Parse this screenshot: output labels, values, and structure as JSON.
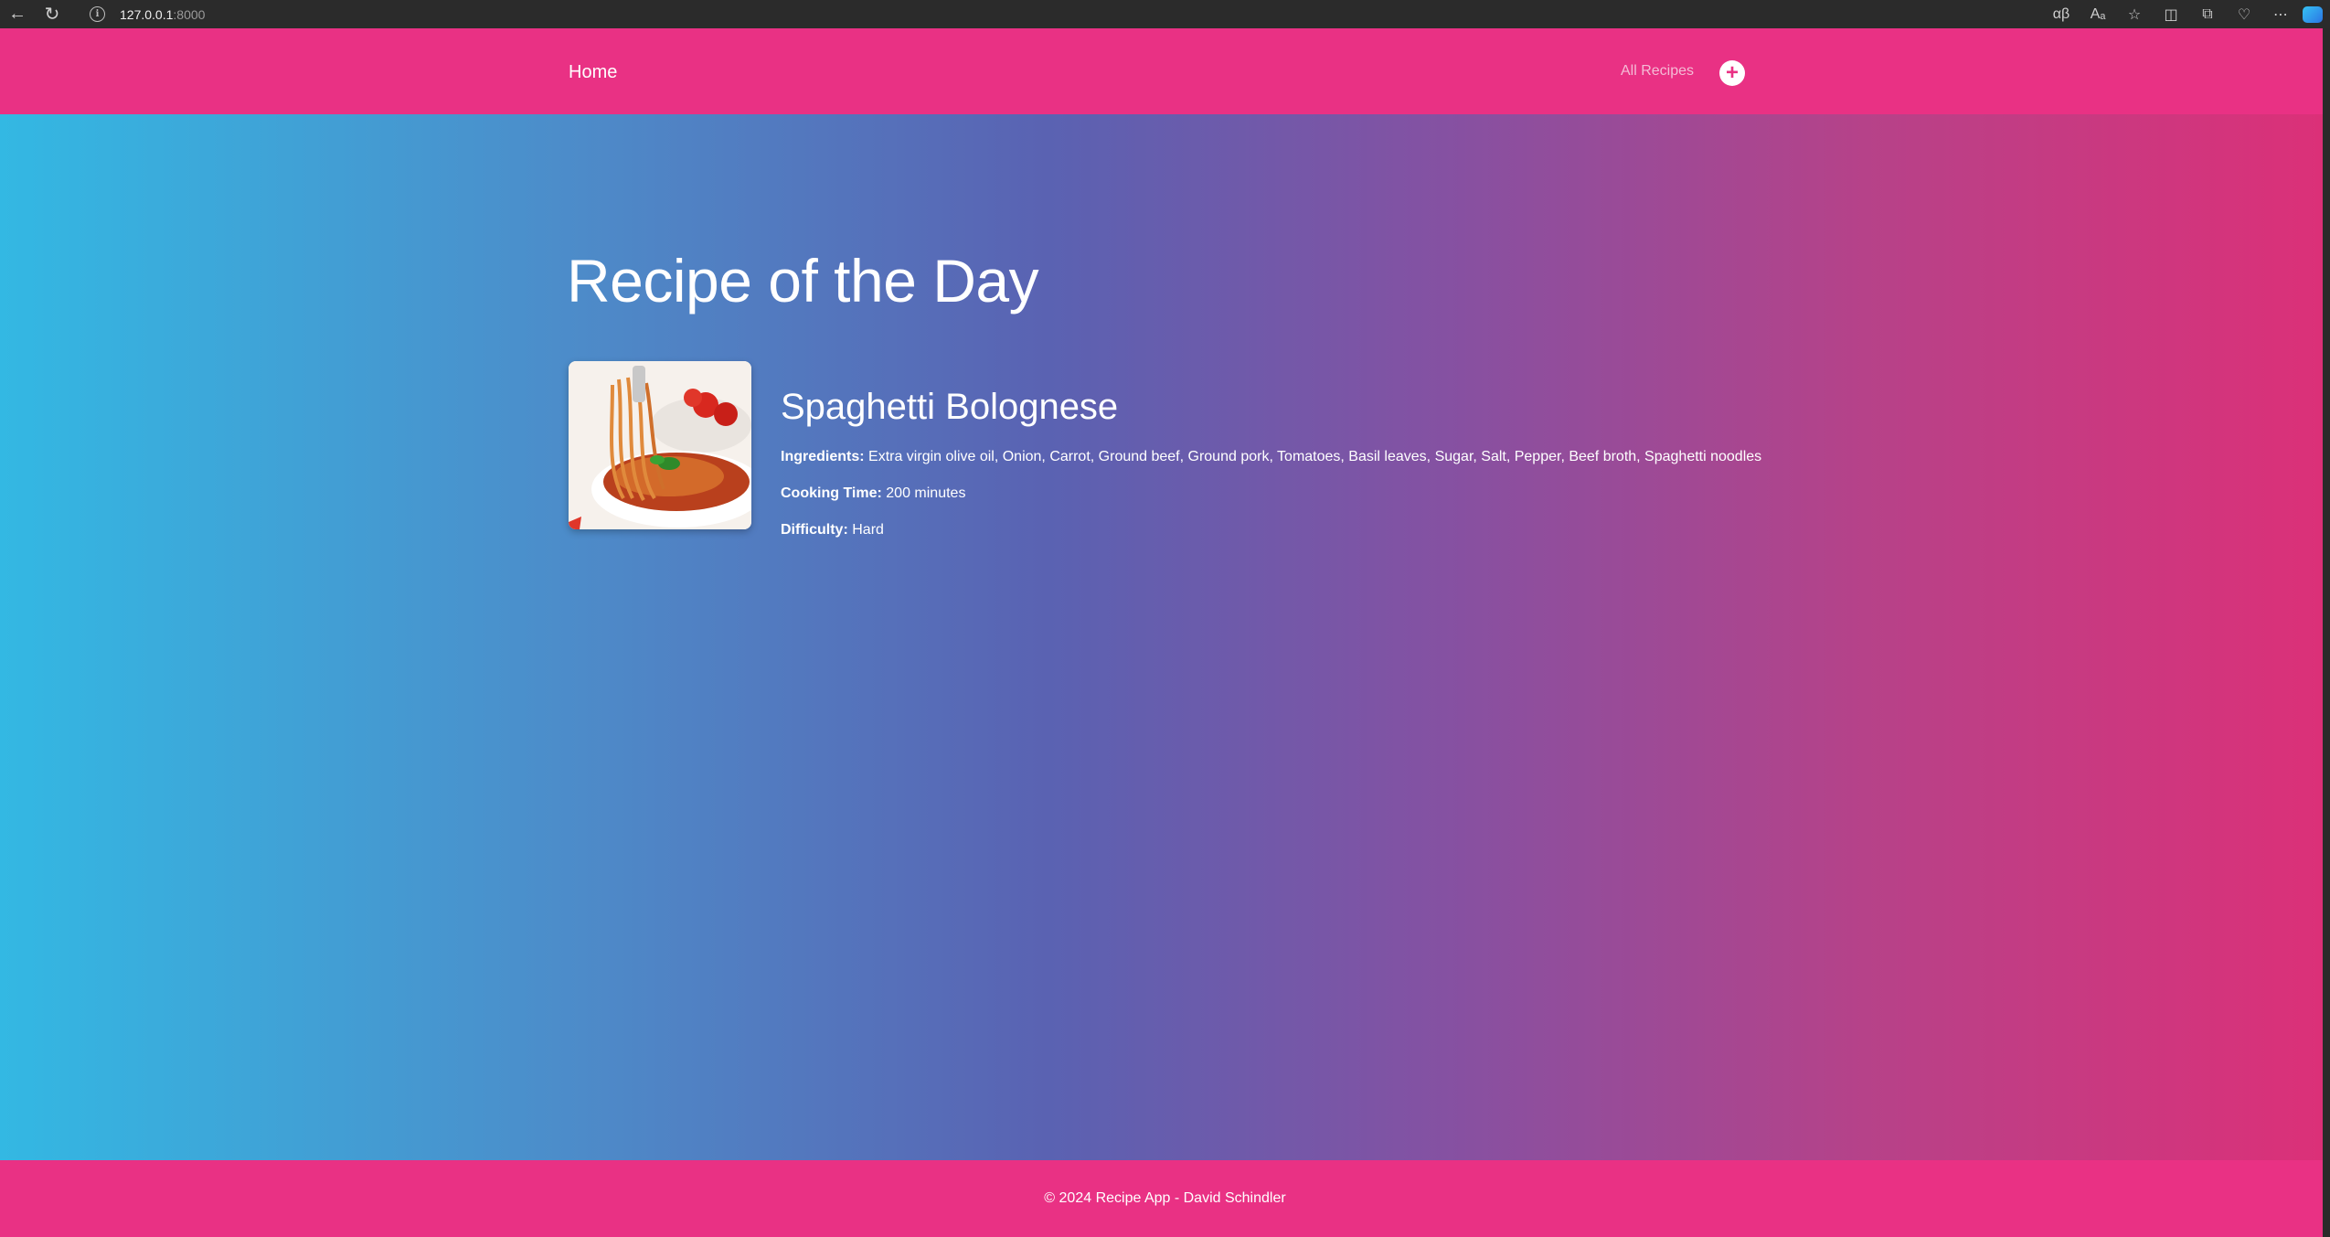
{
  "browser": {
    "url_host": "127.0.0.1",
    "url_port": ":8000"
  },
  "nav": {
    "brand": "Home",
    "all_recipes": "All Recipes",
    "add_symbol": "+"
  },
  "hero": {
    "title": "Recipe of the Day"
  },
  "recipe": {
    "name": "Spaghetti Bolognese",
    "ingredients_label": "Ingredients:",
    "ingredients": "Extra virgin olive oil, Onion, Carrot, Ground beef, Ground pork, Tomatoes, Basil leaves, Sugar, Salt, Pepper, Beef broth, Spaghetti noodles",
    "cooking_time_label": "Cooking Time:",
    "cooking_time": "200 minutes",
    "difficulty_label": "Difficulty:",
    "difficulty": "Hard"
  },
  "footer": {
    "text": "© 2024 Recipe App - David Schindler"
  },
  "colors": {
    "accent": "#e93184",
    "gradient_start": "#33b8e3",
    "gradient_end": "#dc3078"
  }
}
